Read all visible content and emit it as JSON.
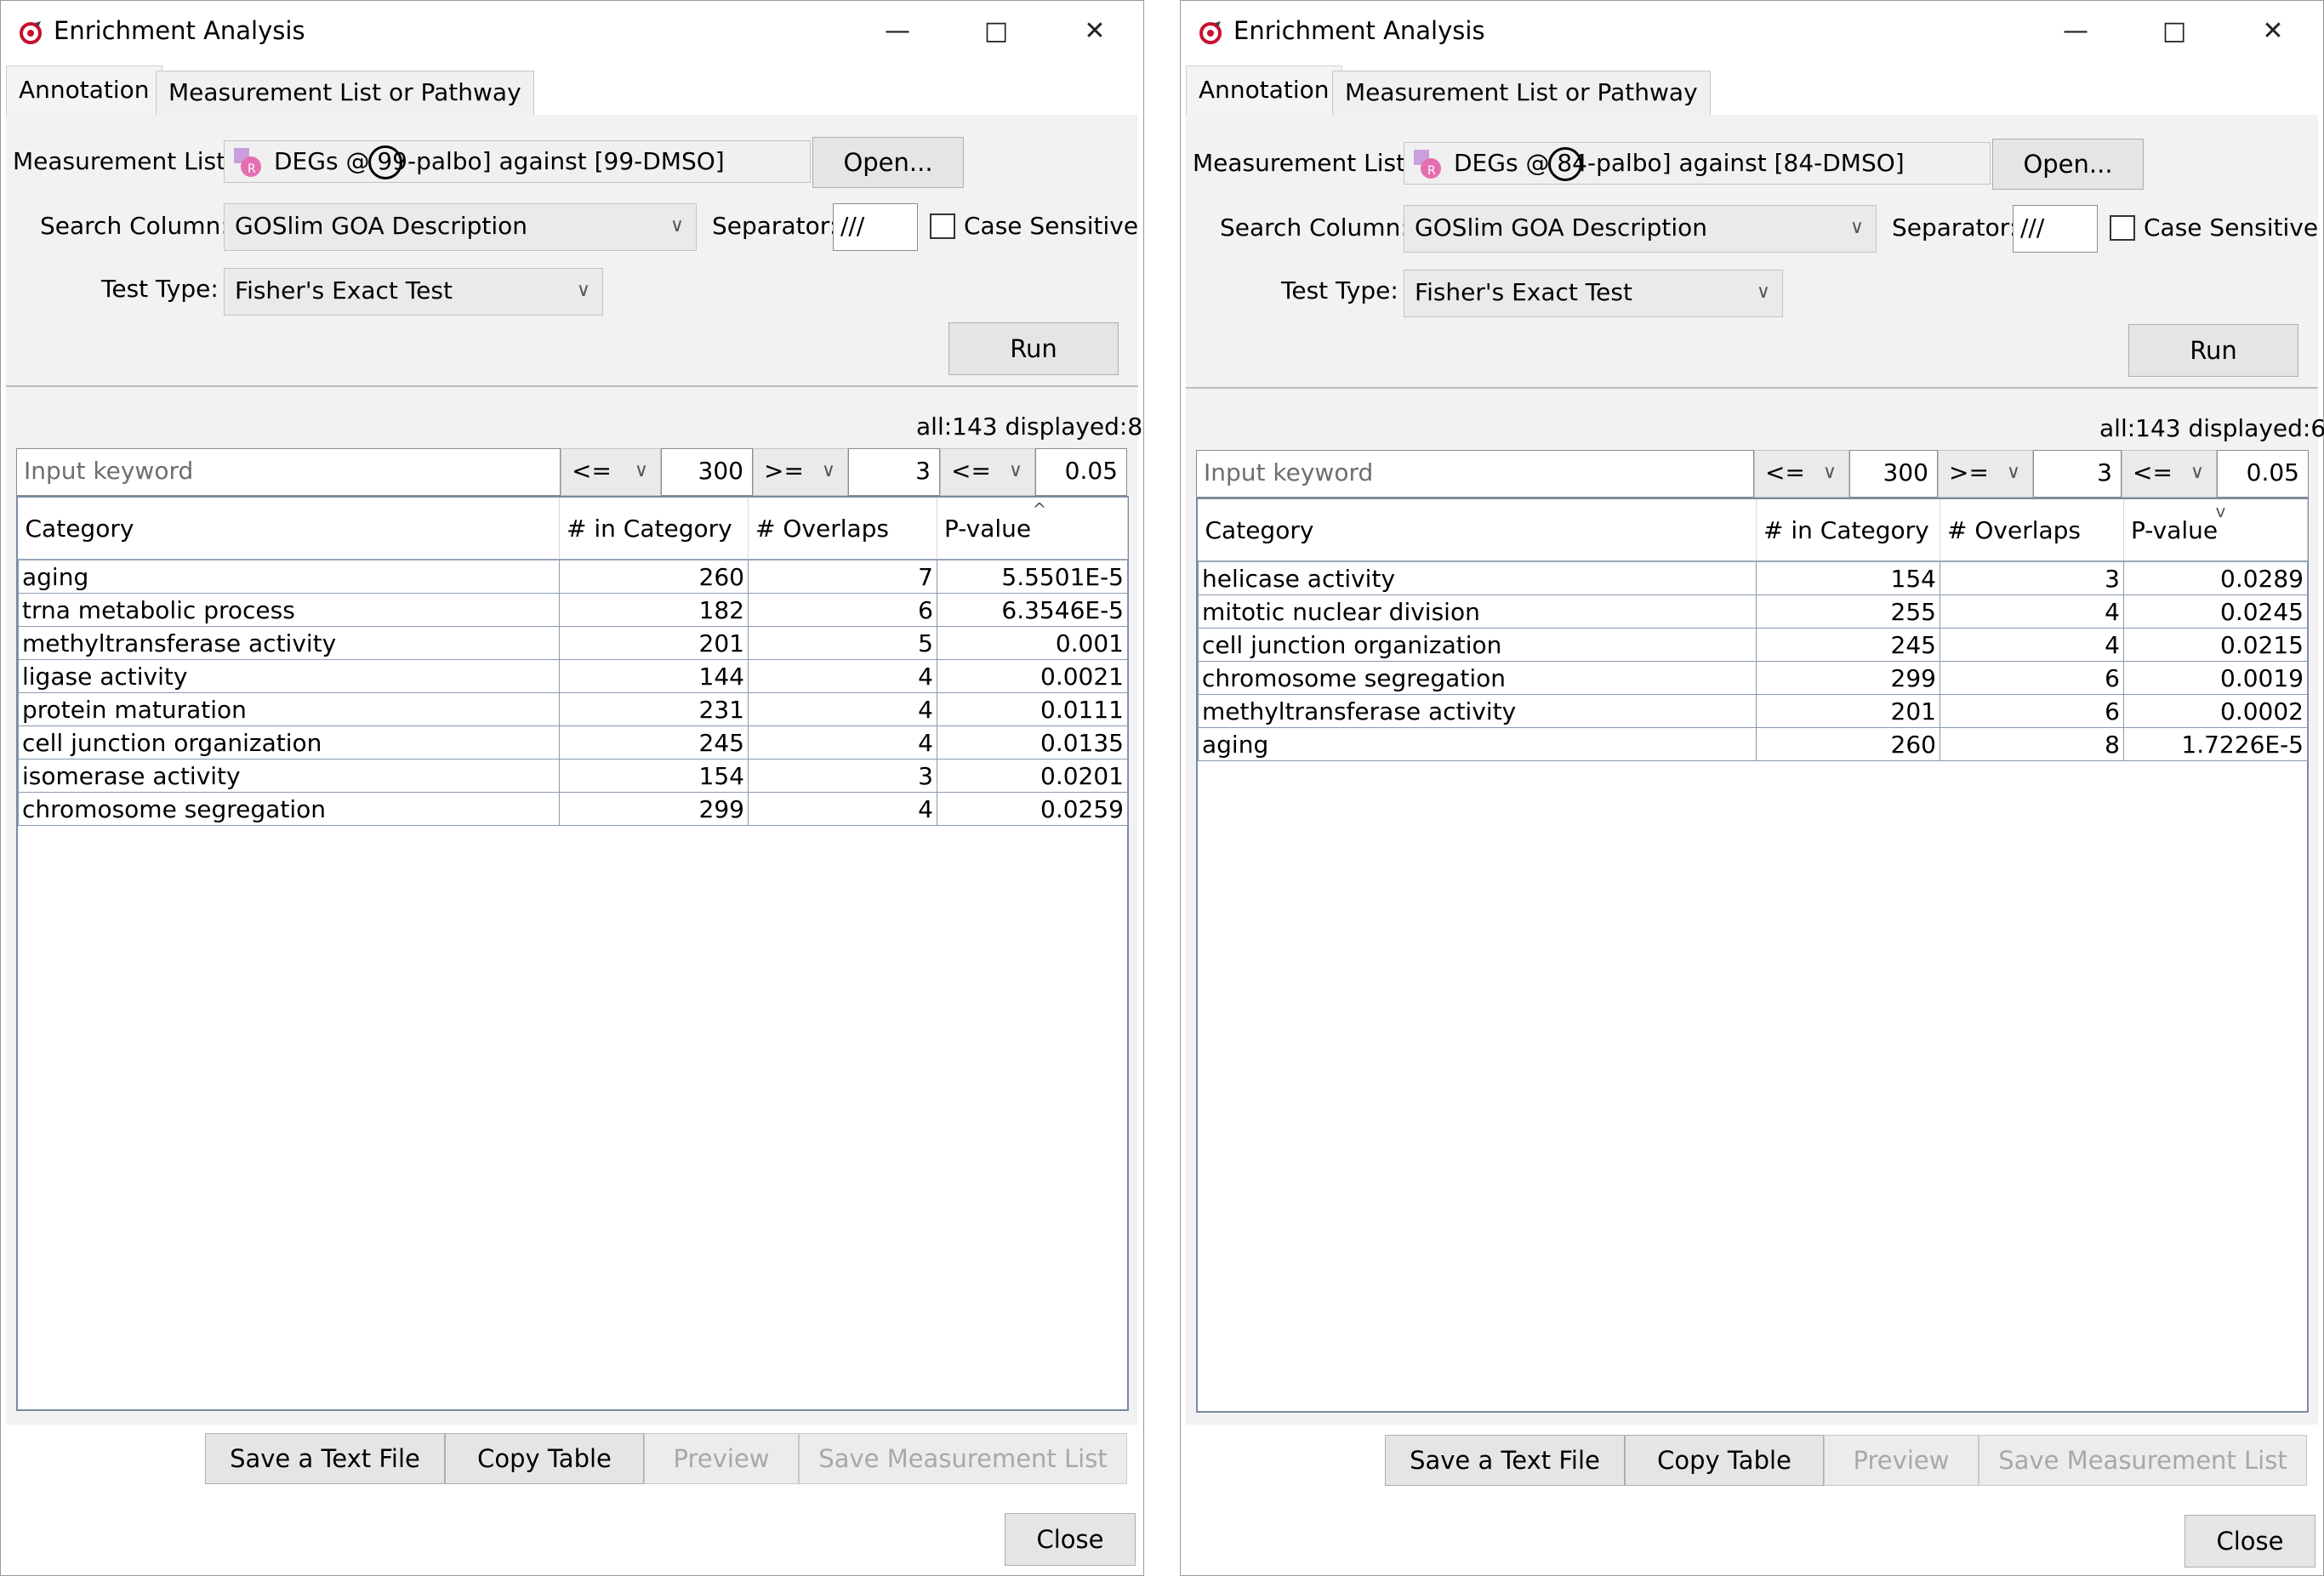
{
  "windows": [
    {
      "title": "Enrichment Analysis",
      "tabs": [
        "Annotation",
        "Measurement List or Pathway"
      ],
      "measurement_list_label": "Measurement List:",
      "measurement_list_value": "DEGs @ 99-palbo] against [99-DMSO]",
      "open_label": "Open...",
      "search_column_label": "Search Column:",
      "search_column_value": "GOSlim GOA Description",
      "separator_label": "Separator:",
      "separator_value": "///",
      "case_sensitive_label": "Case Sensitive",
      "test_type_label": "Test Type:",
      "test_type_value": "Fisher's Exact Test",
      "run_label": "Run",
      "count_text": "all:143 displayed:8",
      "keyword_placeholder": "Input keyword",
      "filter_op1": "<=",
      "filter_val1": "300",
      "filter_op2": ">=",
      "filter_val2": "3",
      "filter_op3": "<=",
      "filter_val3": "0.05",
      "columns": [
        "Category",
        "# in Category",
        "# Overlaps",
        "P-value"
      ],
      "rows": [
        [
          "aging",
          "260",
          "7",
          "5.5501E-5"
        ],
        [
          "trna metabolic process",
          "182",
          "6",
          "6.3546E-5"
        ],
        [
          "methyltransferase activity",
          "201",
          "5",
          "0.001"
        ],
        [
          "ligase activity",
          "144",
          "4",
          "0.0021"
        ],
        [
          "protein maturation",
          "231",
          "4",
          "0.0111"
        ],
        [
          "cell junction organization",
          "245",
          "4",
          "0.0135"
        ],
        [
          "isomerase activity",
          "154",
          "3",
          "0.0201"
        ],
        [
          "chromosome segregation",
          "299",
          "4",
          "0.0259"
        ]
      ],
      "sort_indicator": "^",
      "bottom_buttons": [
        "Save a Text File",
        "Copy Table",
        "Preview",
        "Save Measurement List"
      ],
      "close_label": "Close"
    },
    {
      "title": "Enrichment Analysis",
      "tabs": [
        "Annotation",
        "Measurement List or Pathway"
      ],
      "measurement_list_label": "Measurement List:",
      "measurement_list_value": "DEGs @ 84-palbo] against [84-DMSO]",
      "open_label": "Open...",
      "search_column_label": "Search Column:",
      "search_column_value": "GOSlim GOA Description",
      "separator_label": "Separator:",
      "separator_value": "///",
      "case_sensitive_label": "Case Sensitive",
      "test_type_label": "Test Type:",
      "test_type_value": "Fisher's Exact Test",
      "run_label": "Run",
      "count_text": "all:143 displayed:6",
      "keyword_placeholder": "Input keyword",
      "filter_op1": "<=",
      "filter_val1": "300",
      "filter_op2": ">=",
      "filter_val2": "3",
      "filter_op3": "<=",
      "filter_val3": "0.05",
      "columns": [
        "Category",
        "# in Category",
        "# Overlaps",
        "P-value"
      ],
      "rows": [
        [
          "helicase activity",
          "154",
          "3",
          "0.0289"
        ],
        [
          "mitotic nuclear division",
          "255",
          "4",
          "0.0245"
        ],
        [
          "cell junction organization",
          "245",
          "4",
          "0.0215"
        ],
        [
          "chromosome segregation",
          "299",
          "6",
          "0.0019"
        ],
        [
          "methyltransferase activity",
          "201",
          "6",
          "0.0002"
        ],
        [
          "aging",
          "260",
          "8",
          "1.7226E-5"
        ]
      ],
      "sort_indicator": "v",
      "bottom_buttons": [
        "Save a Text File",
        "Copy Table",
        "Preview",
        "Save Measurement List"
      ],
      "close_label": "Close"
    }
  ]
}
